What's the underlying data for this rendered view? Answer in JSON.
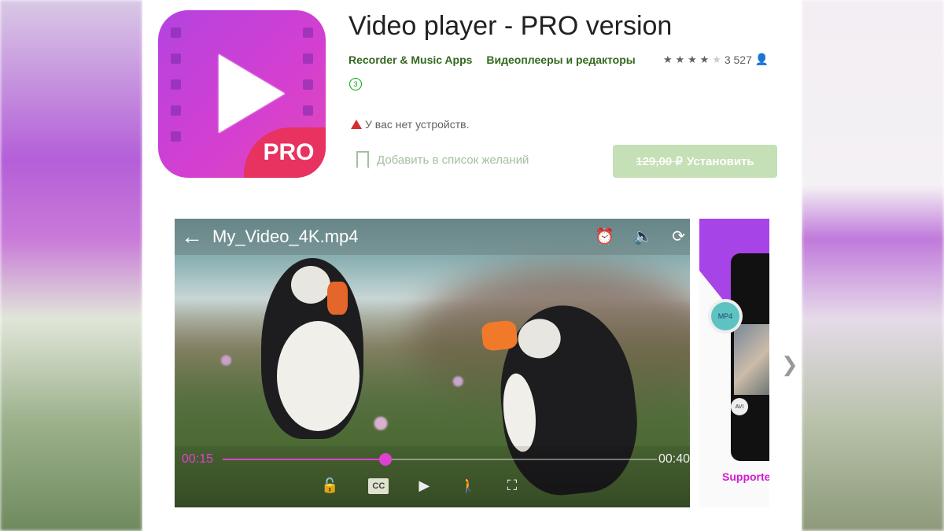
{
  "app": {
    "title": "Video player - PRO version",
    "developer": "Recorder & Music Apps",
    "category": "Видеоплееры и редакторы",
    "rating_stars": 4,
    "rating_max": 5,
    "rating_count": "3 527",
    "age_rating": "3",
    "icon_badge": "PRO"
  },
  "device_warning": "У вас нет устройств.",
  "wishlist_label": "Добавить в список желаний",
  "install": {
    "old_price": "129,00 ₽",
    "label": "Установить",
    "color": "#c5dfb6"
  },
  "screenshot1": {
    "filename": "My_Video_4K.mp4",
    "current_time": "00:15",
    "total_time": "00:40",
    "progress": 0.375,
    "cc_label": "CC",
    "accent": "#e040d0"
  },
  "screenshot2": {
    "caption": "Supporte",
    "badge1": "MP4",
    "badge2": "AVI"
  },
  "colors": {
    "developer_link": "#33691e"
  }
}
